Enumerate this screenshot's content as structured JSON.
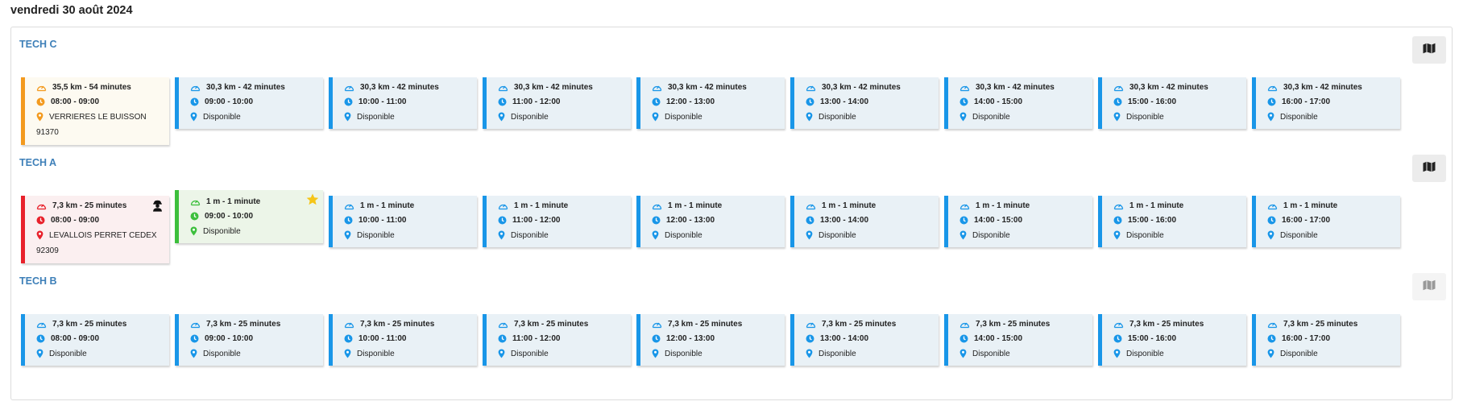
{
  "date": "vendredi 30 août 2024",
  "colors": {
    "blue": "#1996e8",
    "orange": "#f39a1f",
    "red": "#e8212b",
    "green": "#3cbf3c",
    "title": "#3d7fb8"
  },
  "techs": [
    {
      "name": "TECH C",
      "map_enabled": true,
      "cards": [
        {
          "variant": "orange",
          "distance": "35,5 km - 54 minutes",
          "time": "08:00 - 09:00",
          "location": "VERRIERES LE BUISSON",
          "postal": "91370"
        },
        {
          "variant": "blue",
          "distance": "30,3 km - 42 minutes",
          "time": "09:00 - 10:00",
          "location": "Disponible"
        },
        {
          "variant": "blue",
          "distance": "30,3 km - 42 minutes",
          "time": "10:00 - 11:00",
          "location": "Disponible"
        },
        {
          "variant": "blue",
          "distance": "30,3 km - 42 minutes",
          "time": "11:00 - 12:00",
          "location": "Disponible"
        },
        {
          "variant": "blue",
          "distance": "30,3 km - 42 minutes",
          "time": "12:00 - 13:00",
          "location": "Disponible"
        },
        {
          "variant": "blue",
          "distance": "30,3 km - 42 minutes",
          "time": "13:00 - 14:00",
          "location": "Disponible"
        },
        {
          "variant": "blue",
          "distance": "30,3 km - 42 minutes",
          "time": "14:00 - 15:00",
          "location": "Disponible"
        },
        {
          "variant": "blue",
          "distance": "30,3 km - 42 minutes",
          "time": "15:00 - 16:00",
          "location": "Disponible"
        },
        {
          "variant": "blue",
          "distance": "30,3 km - 42 minutes",
          "time": "16:00 - 17:00",
          "location": "Disponible"
        }
      ]
    },
    {
      "name": "TECH A",
      "map_enabled": true,
      "cards": [
        {
          "variant": "red",
          "distance": "7,3 km - 25 minutes",
          "time": "08:00 - 09:00",
          "location": "LEVALLOIS PERRET CEDEX",
          "postal": "92309",
          "corner_icon": "technician-icon"
        },
        {
          "variant": "green",
          "distance": "1 m - 1 minute",
          "time": "09:00 - 10:00",
          "location": "Disponible",
          "corner_icon": "star-icon"
        },
        {
          "variant": "blue",
          "distance": "1 m - 1 minute",
          "time": "10:00 - 11:00",
          "location": "Disponible"
        },
        {
          "variant": "blue",
          "distance": "1 m - 1 minute",
          "time": "11:00 - 12:00",
          "location": "Disponible"
        },
        {
          "variant": "blue",
          "distance": "1 m - 1 minute",
          "time": "12:00 - 13:00",
          "location": "Disponible"
        },
        {
          "variant": "blue",
          "distance": "1 m - 1 minute",
          "time": "13:00 - 14:00",
          "location": "Disponible"
        },
        {
          "variant": "blue",
          "distance": "1 m - 1 minute",
          "time": "14:00 - 15:00",
          "location": "Disponible"
        },
        {
          "variant": "blue",
          "distance": "1 m - 1 minute",
          "time": "15:00 - 16:00",
          "location": "Disponible"
        },
        {
          "variant": "blue",
          "distance": "1 m - 1 minute",
          "time": "16:00 - 17:00",
          "location": "Disponible"
        }
      ]
    },
    {
      "name": "TECH B",
      "map_enabled": false,
      "cards": [
        {
          "variant": "blue",
          "distance": "7,3 km - 25 minutes",
          "time": "08:00 - 09:00",
          "location": "Disponible"
        },
        {
          "variant": "blue",
          "distance": "7,3 km - 25 minutes",
          "time": "09:00 - 10:00",
          "location": "Disponible"
        },
        {
          "variant": "blue",
          "distance": "7,3 km - 25 minutes",
          "time": "10:00 - 11:00",
          "location": "Disponible"
        },
        {
          "variant": "blue",
          "distance": "7,3 km - 25 minutes",
          "time": "11:00 - 12:00",
          "location": "Disponible"
        },
        {
          "variant": "blue",
          "distance": "7,3 km - 25 minutes",
          "time": "12:00 - 13:00",
          "location": "Disponible"
        },
        {
          "variant": "blue",
          "distance": "7,3 km - 25 minutes",
          "time": "13:00 - 14:00",
          "location": "Disponible"
        },
        {
          "variant": "blue",
          "distance": "7,3 km - 25 minutes",
          "time": "14:00 - 15:00",
          "location": "Disponible"
        },
        {
          "variant": "blue",
          "distance": "7,3 km - 25 minutes",
          "time": "15:00 - 16:00",
          "location": "Disponible"
        },
        {
          "variant": "blue",
          "distance": "7,3 km - 25 minutes",
          "time": "16:00 - 17:00",
          "location": "Disponible"
        }
      ]
    }
  ]
}
